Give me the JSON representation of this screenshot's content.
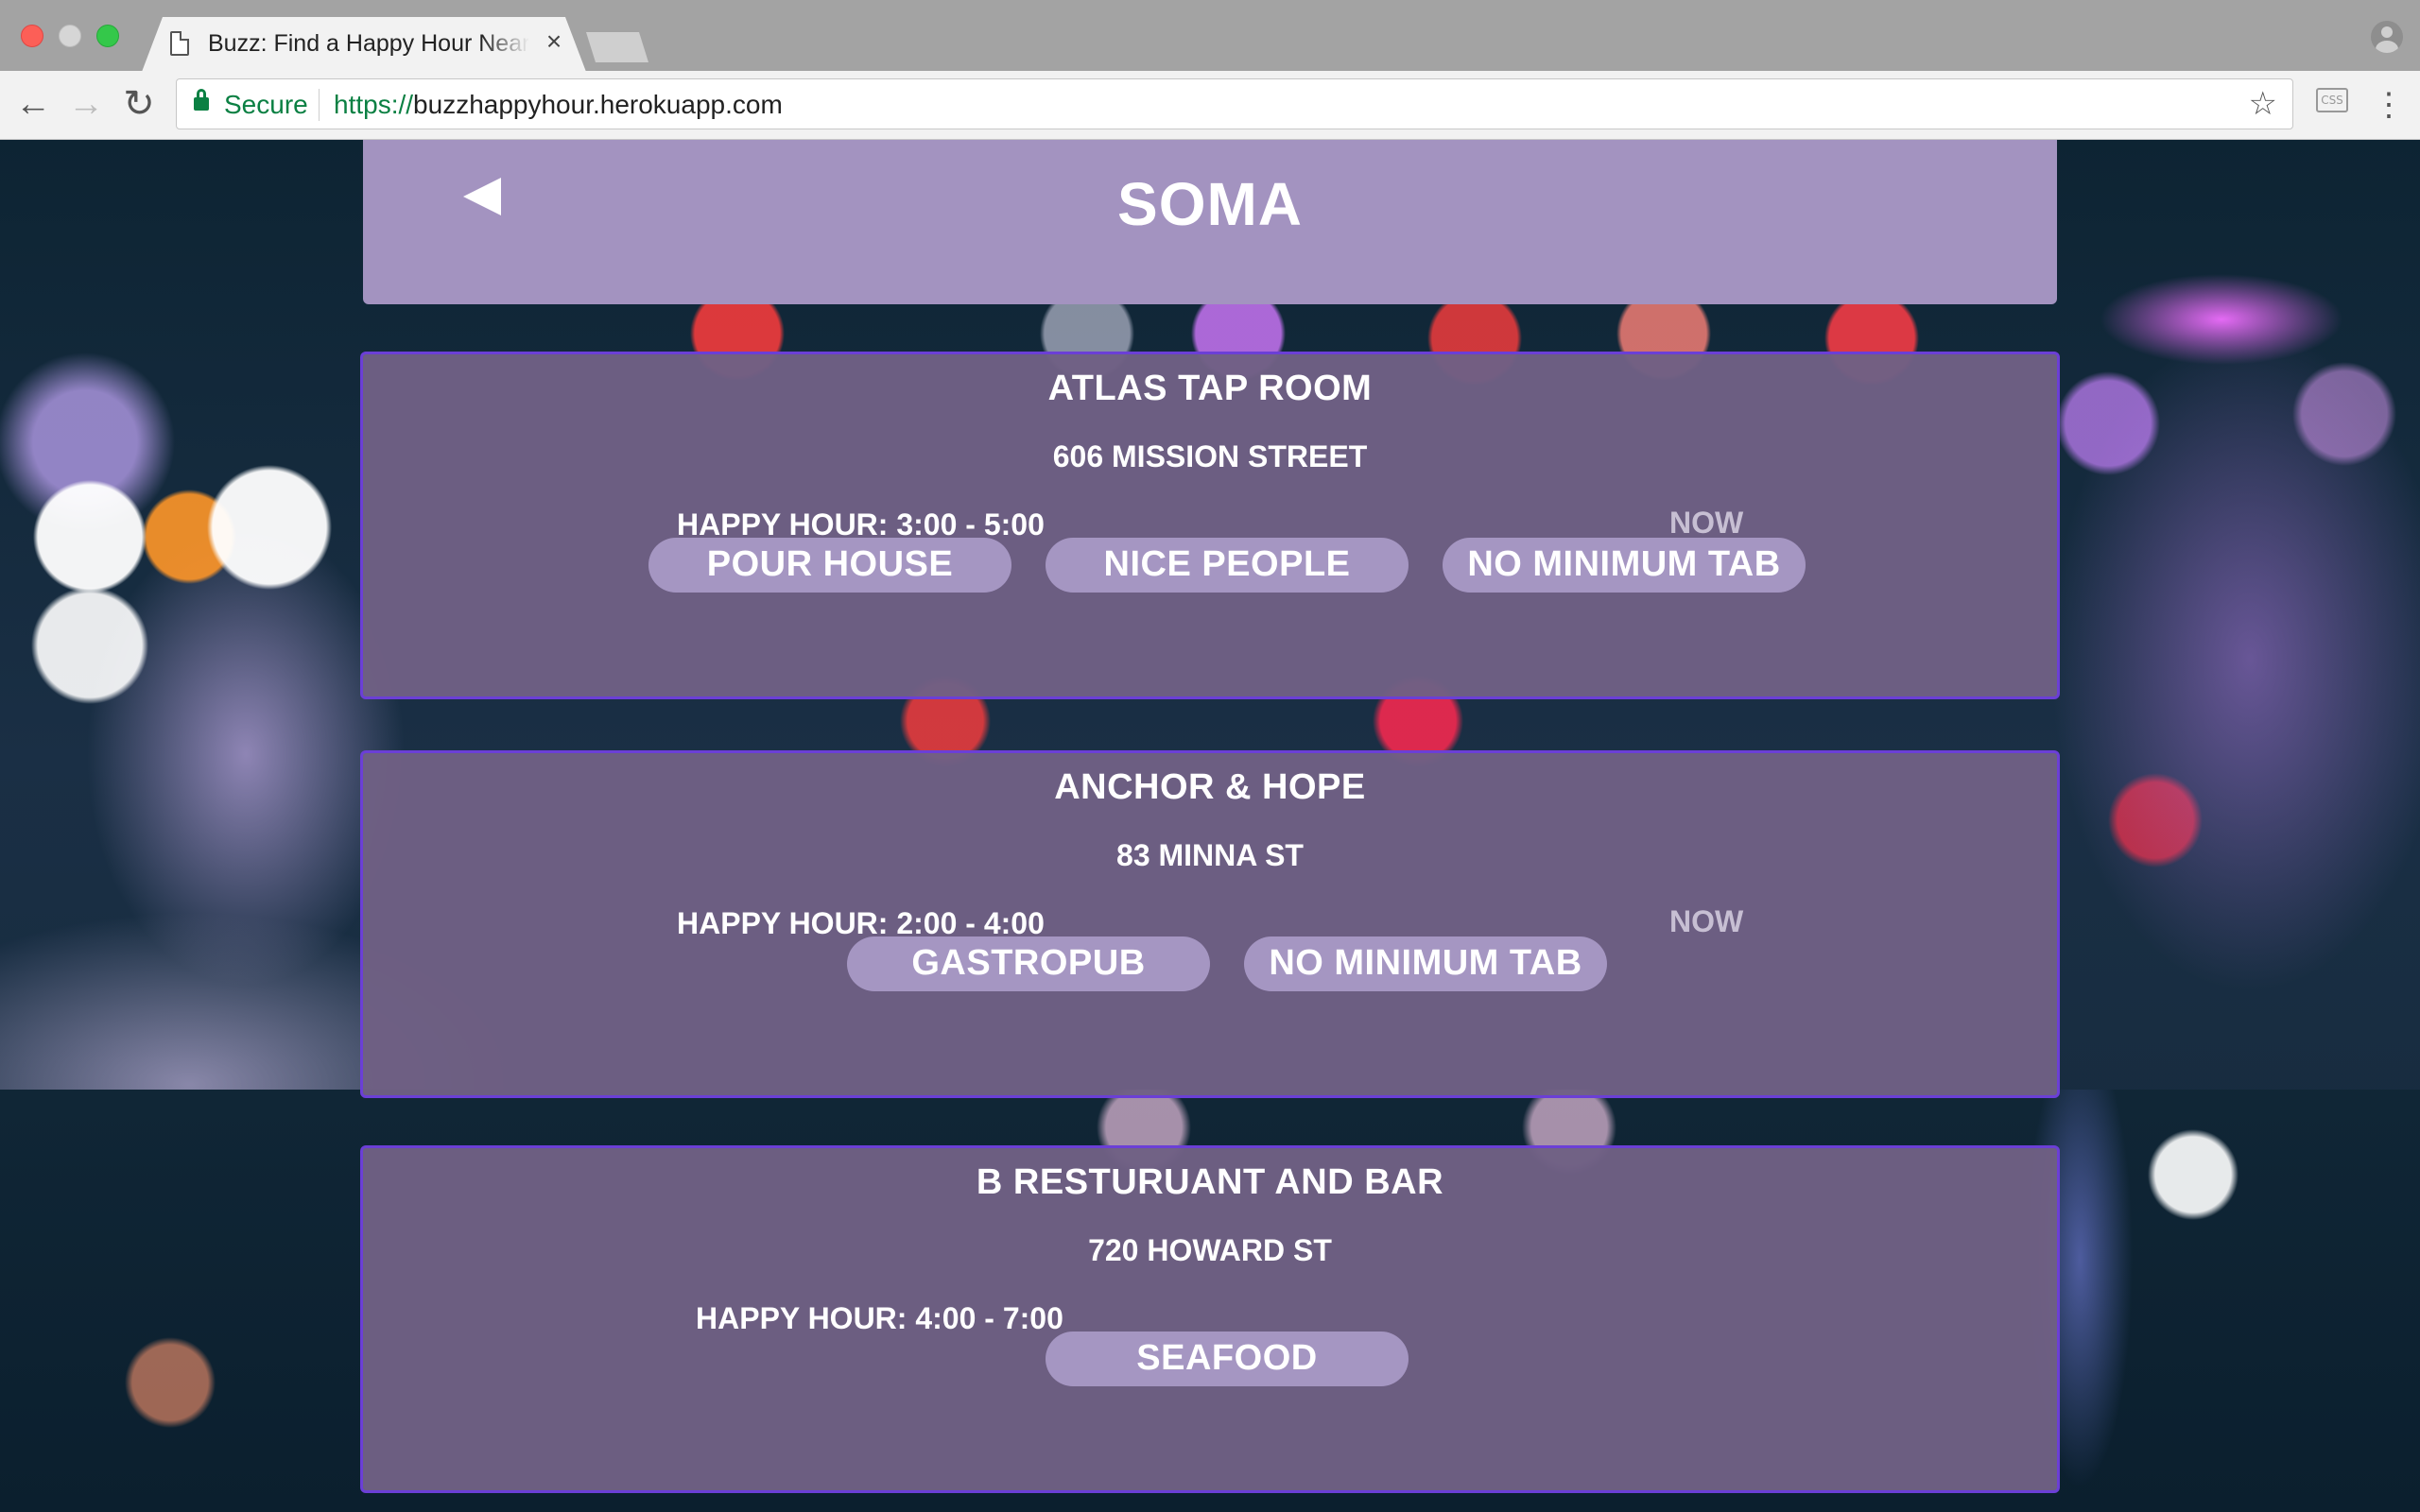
{
  "browser": {
    "tab_title": "Buzz: Find a Happy Hour Near",
    "tab_close": "×",
    "secure_label": "Secure",
    "url_scheme": "https://",
    "url_host": "buzzhappyhour.herokuapp.com",
    "extension_label": "CSS"
  },
  "header": {
    "title": "SOMA"
  },
  "colors": {
    "header_bg": "#a393c0",
    "card_bg": "#706084",
    "card_border": "#6b3fd6",
    "tag_bg": "#a596c2",
    "now_text": "#c7bfd3"
  },
  "bars": [
    {
      "name": "ATLAS TAP ROOM",
      "address": "606 MISSION STREET",
      "happy_hour": "HAPPY HOUR: 3:00 - 5:00",
      "status": "NOW",
      "tags": [
        "POUR HOUSE",
        "NICE PEOPLE",
        "NO MINIMUM TAB"
      ]
    },
    {
      "name": "ANCHOR & HOPE",
      "address": "83 MINNA ST",
      "happy_hour": "HAPPY HOUR: 2:00 - 4:00",
      "status": "NOW",
      "tags": [
        "GASTROPUB",
        "NO MINIMUM TAB"
      ]
    },
    {
      "name": "B RESTURUANT AND BAR",
      "address": "720 HOWARD ST",
      "happy_hour": "HAPPY HOUR: 4:00 - 7:00",
      "status": "",
      "tags": [
        "SEAFOOD"
      ]
    }
  ]
}
